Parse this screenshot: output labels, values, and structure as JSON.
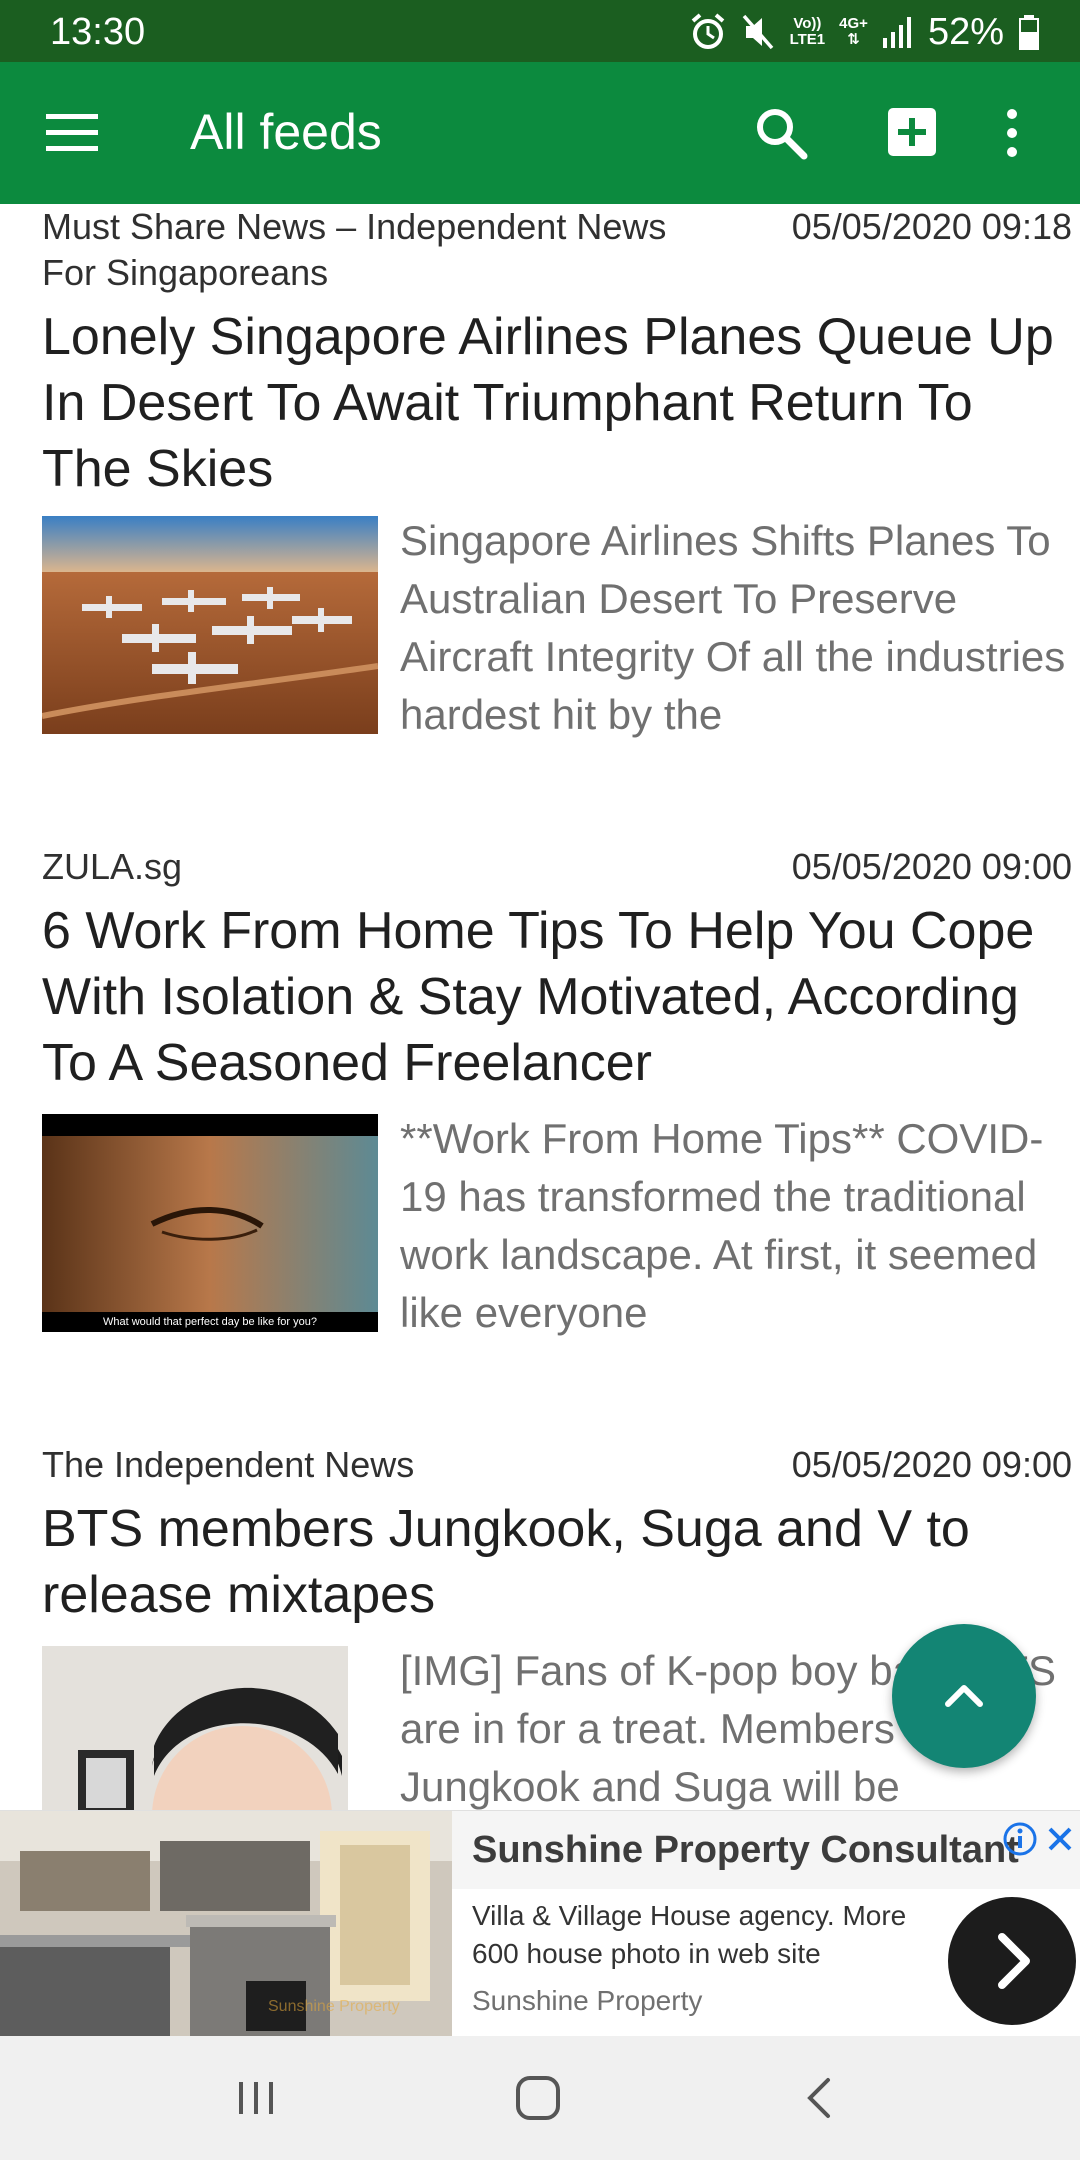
{
  "status_bar": {
    "time": "13:30",
    "network_top": "Vo))",
    "network_bottom": "LTE1",
    "data_type": "4G+",
    "battery": "52%",
    "icons": [
      "alarm-icon",
      "mute-icon",
      "signal-icon",
      "battery-icon"
    ]
  },
  "app_bar": {
    "title": "All feeds",
    "actions": [
      "menu-icon",
      "search-icon",
      "add-box-icon",
      "more-vert-icon"
    ]
  },
  "articles": [
    {
      "source": "Must Share News – Independent News For Singaporeans",
      "date": "05/05/2020 09:18",
      "title": "Lonely Singapore Airlines Planes Queue Up In Desert To Await Triumphant Return To The Skies",
      "summary": "Singapore Airlines Shifts Planes To Australian Desert To Preserve Aircraft Integrity Of all the industries hardest hit by the",
      "thumbnail": "desert-airplanes-photo"
    },
    {
      "source": "ZULA.sg",
      "date": "05/05/2020 09:00",
      "title": "6 Work From Home Tips To Help You Cope With Isolation & Stay Motivated, According To A Seasoned Freelancer",
      "summary": "**Work From Home Tips** COVID-19 has transformed the traditional work landscape. At first, it seemed like everyone",
      "thumbnail": "woman-eye-closeup-photo",
      "thumbnail_caption": "What would that perfect day be like for you?"
    },
    {
      "source": "The Independent News",
      "date": "05/05/2020 09:00",
      "title": "BTS members Jungkook, Suga and V to release mixtapes",
      "summary": "[IMG] Fans of K-pop boy band BTS are in for a treat. Members Jungkook and Suga will be",
      "thumbnail": "person-portrait-photo"
    }
  ],
  "fab": {
    "icon": "chevron-up-icon"
  },
  "ad": {
    "title": "Sunshine Property Consultant",
    "description": "Villa & Village House agency. More 600 house photo in web site",
    "advertiser": "Sunshine Property",
    "image_watermark": "Sunshine Property",
    "cta_icon": "chevron-right-icon"
  },
  "nav_bar": {
    "buttons": [
      "recent-apps-icon",
      "home-icon",
      "back-icon"
    ]
  },
  "colors": {
    "status_bar": "#1b5e20",
    "app_bar": "#0c8a3e",
    "fab": "#138574"
  }
}
